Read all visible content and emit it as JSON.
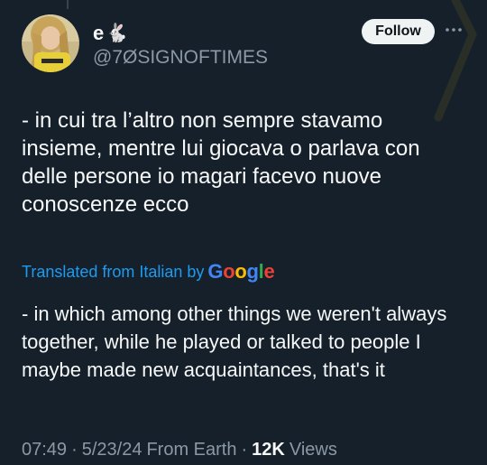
{
  "author": {
    "display_name": "e",
    "emoji": "🐇",
    "handle": "@7ØSIGNOFTIMES",
    "avatar_icon": "avatar-photo"
  },
  "actions": {
    "follow_label": "Follow",
    "more_icon": "more-dots-icon"
  },
  "tweet": {
    "original_text": "- in cui tra l’altro non sempre stavamo insieme, mentre lui giocava o parlava con delle persone io magari facevo nuove conoscenze ecco",
    "translated_from_label": "Translated from Italian by",
    "translation_provider": "Google",
    "translated_text": "- in which among other things we weren't always together, while he played or talked to people I maybe made new acquaintances, that's it"
  },
  "meta": {
    "time": "07:49",
    "date": "5/23/24",
    "location": "From Earth",
    "separator": "·",
    "views_count": "12K",
    "views_label": "Views"
  },
  "colors": {
    "background": "#15202b",
    "text_primary": "#f7f9f9",
    "text_secondary": "#8b98a5",
    "link": "#1d9bf0",
    "follow_bg": "#eff3f4"
  }
}
